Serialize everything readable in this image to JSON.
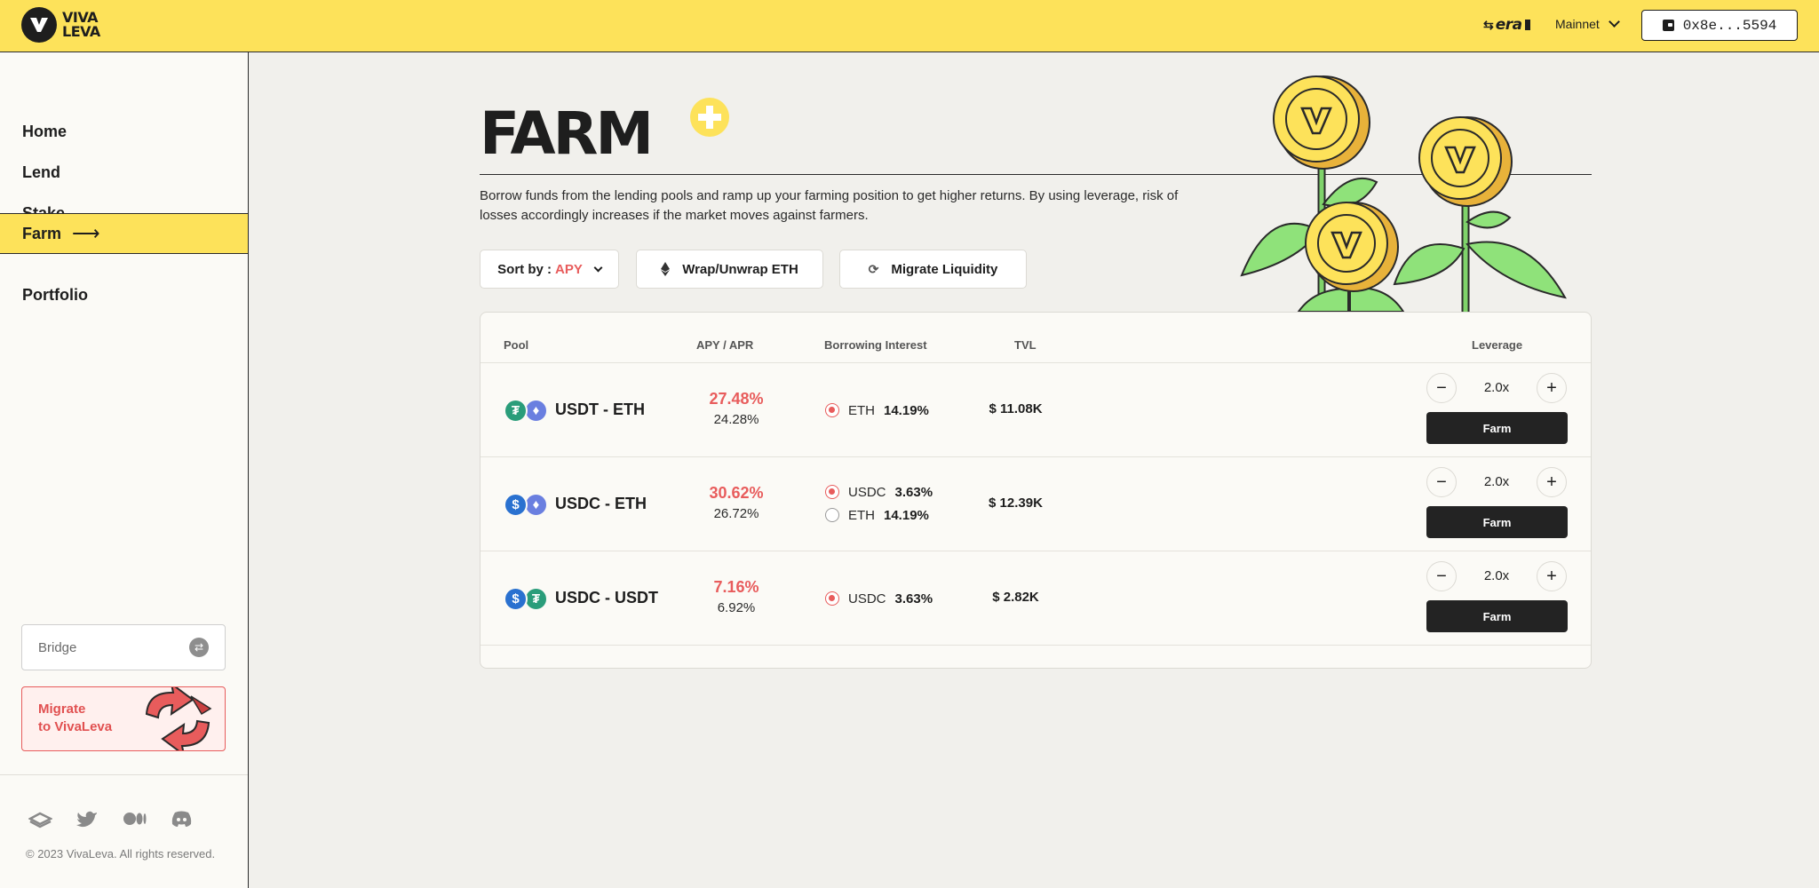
{
  "header": {
    "brand_line1": "VIVA",
    "brand_line2": "LEVA",
    "network_logo": "era",
    "network": "Mainnet",
    "wallet": "0x8e...5594"
  },
  "sidebar": {
    "items": [
      {
        "label": "Home"
      },
      {
        "label": "Lend"
      },
      {
        "label": "Stake"
      },
      {
        "label": "Farm",
        "active": true
      },
      {
        "label": "Portfolio"
      }
    ],
    "bridge_label": "Bridge",
    "migrate_line1": "Migrate",
    "migrate_line2": "to VivaLeva",
    "socials": [
      "gitbook-icon",
      "twitter-icon",
      "medium-icon",
      "discord-icon"
    ],
    "copyright": "© 2023 VivaLeva. All rights reserved."
  },
  "page": {
    "title": "FARM",
    "description": "Borrow funds from the lending pools and ramp up your farming position to get higher returns. By using leverage, risk of losses accordingly increases if the market moves against farmers."
  },
  "toolbar": {
    "sort_label": "Sort by :",
    "sort_value": "APY",
    "wrap_label": "Wrap/Unwrap ETH",
    "migrate_label": "Migrate Liquidity"
  },
  "table": {
    "headers": {
      "pool": "Pool",
      "apy": "APY / APR",
      "borrow": "Borrowing Interest",
      "tvl": "TVL",
      "leverage": "Leverage"
    },
    "farm_label": "Farm",
    "rows": [
      {
        "token_a": "usdt",
        "token_b": "eth",
        "pool": "USDT - ETH",
        "apy": "27.48%",
        "apr": "24.28%",
        "borrow": [
          {
            "asset": "ETH",
            "rate": "14.19%",
            "selected": true
          }
        ],
        "tvl": "$ 11.08K",
        "leverage": "2.0x"
      },
      {
        "token_a": "usdc",
        "token_b": "eth",
        "pool": "USDC - ETH",
        "apy": "30.62%",
        "apr": "26.72%",
        "borrow": [
          {
            "asset": "USDC",
            "rate": "3.63%",
            "selected": true
          },
          {
            "asset": "ETH",
            "rate": "14.19%",
            "selected": false
          }
        ],
        "tvl": "$ 12.39K",
        "leverage": "2.0x"
      },
      {
        "token_a": "usdc",
        "token_b": "usdt",
        "pool": "USDC - USDT",
        "apy": "7.16%",
        "apr": "6.92%",
        "borrow": [
          {
            "asset": "USDC",
            "rate": "3.63%",
            "selected": true
          }
        ],
        "tvl": "$ 2.82K",
        "leverage": "2.0x"
      }
    ]
  },
  "colors": {
    "accent_yellow": "#fde25a",
    "accent_red": "#e85c5c",
    "dark": "#232323"
  }
}
